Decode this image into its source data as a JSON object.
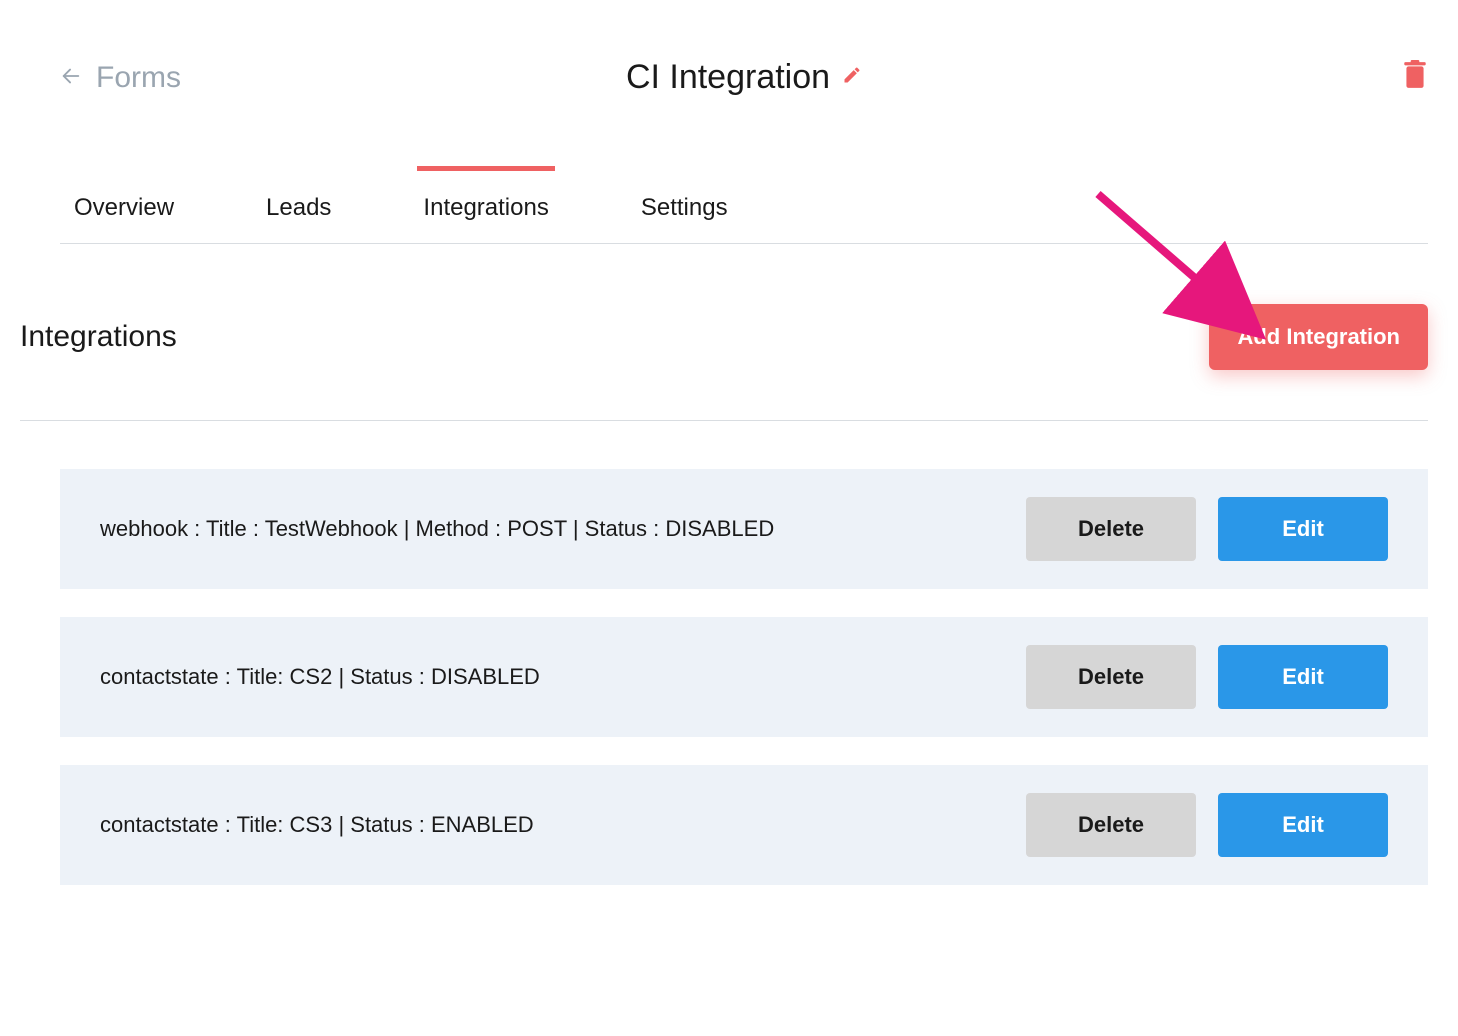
{
  "header": {
    "back_label": "Forms",
    "title": "CI Integration"
  },
  "tabs": [
    {
      "label": "Overview",
      "active": false
    },
    {
      "label": "Leads",
      "active": false
    },
    {
      "label": "Integrations",
      "active": true
    },
    {
      "label": "Settings",
      "active": false
    }
  ],
  "section": {
    "title": "Integrations",
    "add_button": "Add Integration"
  },
  "integrations": [
    {
      "text": "webhook : Title : TestWebhook | Method : POST | Status : DISABLED"
    },
    {
      "text": "contactstate : Title: CS2 | Status : DISABLED"
    },
    {
      "text": "contactstate : Title: CS3 | Status : ENABLED"
    }
  ],
  "buttons": {
    "delete": "Delete",
    "edit": "Edit"
  },
  "colors": {
    "accent": "#EF6162",
    "primary_blue": "#2a97e8",
    "row_bg": "#edf2f8",
    "muted": "#9aa5b0",
    "arrow": "#e6177c"
  }
}
